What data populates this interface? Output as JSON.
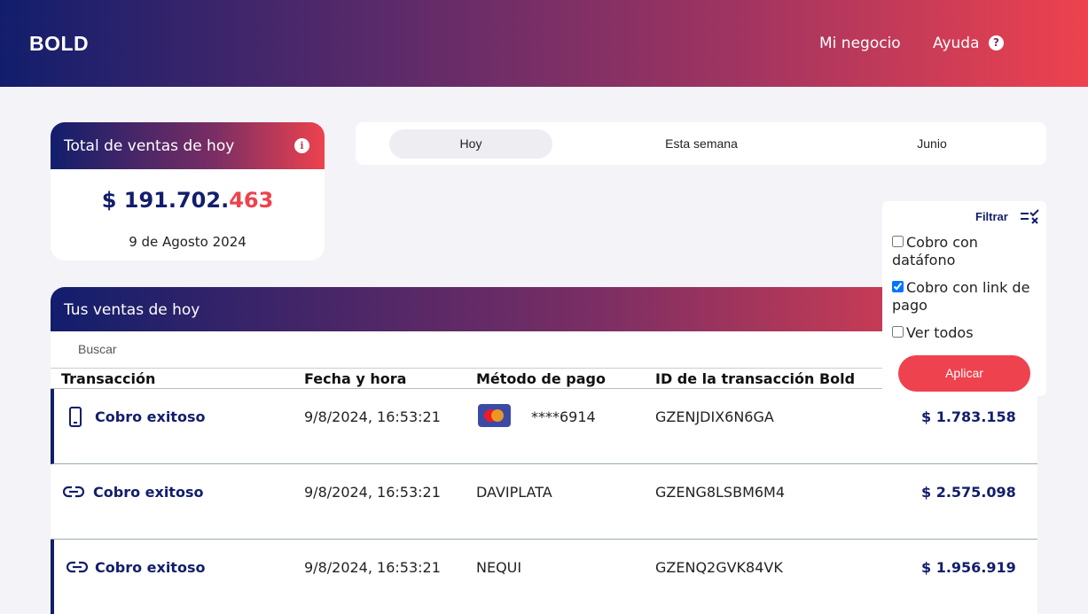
{
  "header": {
    "logo": "BOLD",
    "nav_negocio": "Mi negocio",
    "nav_ayuda": "Ayuda",
    "help_icon": "question-circle-icon"
  },
  "total_card": {
    "title": "Total de ventas de hoy",
    "amount_main": "$ 191.702.",
    "amount_decimals": "463",
    "date": "9 de Agosto 2024"
  },
  "tabs": [
    {
      "label": "Hoy",
      "active": true
    },
    {
      "label": "Esta semana",
      "active": false
    },
    {
      "label": "Junio",
      "active": false
    }
  ],
  "filter": {
    "label": "Filtrar",
    "options": [
      {
        "label": "Cobro con datáfono",
        "checked": false
      },
      {
        "label": "Cobro con link de pago",
        "checked": true
      },
      {
        "label": "Ver todos",
        "checked": false
      }
    ],
    "apply_label": "Aplicar"
  },
  "sales": {
    "title": "Tus ventas de hoy",
    "search_placeholder": "Buscar",
    "columns": [
      "Transacción",
      "Fecha y hora",
      "Método de pago",
      "ID de la transacción Bold"
    ],
    "rows": [
      {
        "type_icon": "phone-icon",
        "status": "Cobro exitoso",
        "datetime": "9/8/2024, 16:53:21",
        "method_icon": "mastercard-icon",
        "method": "****6914",
        "id": "GZENJDIX6N6GA",
        "amount": "$ 1.783.158"
      },
      {
        "type_icon": "link-icon",
        "status": "Cobro exitoso",
        "datetime": "9/8/2024, 16:53:21",
        "method": "DAVIPLATA",
        "id": "GZENG8LSBM6M4",
        "amount": "$ 2.575.098"
      },
      {
        "type_icon": "link-icon",
        "status": "Cobro exitoso",
        "datetime": "9/8/2024, 16:53:21",
        "method": "NEQUI",
        "id": "GZENQ2GVK84VK",
        "amount": "$ 1.956.919"
      }
    ]
  },
  "colors": {
    "brand_blue": "#121e6c",
    "brand_red": "#ee424e",
    "background": "#f3f3f8"
  }
}
